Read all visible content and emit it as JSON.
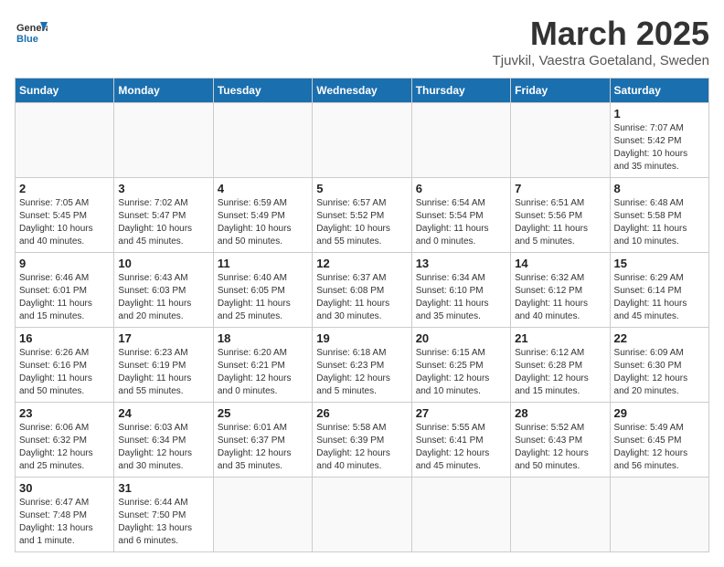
{
  "header": {
    "logo_general": "General",
    "logo_blue": "Blue",
    "month_title": "March 2025",
    "location": "Tjuvkil, Vaestra Goetaland, Sweden"
  },
  "weekdays": [
    "Sunday",
    "Monday",
    "Tuesday",
    "Wednesday",
    "Thursday",
    "Friday",
    "Saturday"
  ],
  "weeks": [
    [
      {
        "day": "",
        "info": ""
      },
      {
        "day": "",
        "info": ""
      },
      {
        "day": "",
        "info": ""
      },
      {
        "day": "",
        "info": ""
      },
      {
        "day": "",
        "info": ""
      },
      {
        "day": "",
        "info": ""
      },
      {
        "day": "1",
        "info": "Sunrise: 7:07 AM\nSunset: 5:42 PM\nDaylight: 10 hours\nand 35 minutes."
      }
    ],
    [
      {
        "day": "2",
        "info": "Sunrise: 7:05 AM\nSunset: 5:45 PM\nDaylight: 10 hours\nand 40 minutes."
      },
      {
        "day": "3",
        "info": "Sunrise: 7:02 AM\nSunset: 5:47 PM\nDaylight: 10 hours\nand 45 minutes."
      },
      {
        "day": "4",
        "info": "Sunrise: 6:59 AM\nSunset: 5:49 PM\nDaylight: 10 hours\nand 50 minutes."
      },
      {
        "day": "5",
        "info": "Sunrise: 6:57 AM\nSunset: 5:52 PM\nDaylight: 10 hours\nand 55 minutes."
      },
      {
        "day": "6",
        "info": "Sunrise: 6:54 AM\nSunset: 5:54 PM\nDaylight: 11 hours\nand 0 minutes."
      },
      {
        "day": "7",
        "info": "Sunrise: 6:51 AM\nSunset: 5:56 PM\nDaylight: 11 hours\nand 5 minutes."
      },
      {
        "day": "8",
        "info": "Sunrise: 6:48 AM\nSunset: 5:58 PM\nDaylight: 11 hours\nand 10 minutes."
      }
    ],
    [
      {
        "day": "9",
        "info": "Sunrise: 6:46 AM\nSunset: 6:01 PM\nDaylight: 11 hours\nand 15 minutes."
      },
      {
        "day": "10",
        "info": "Sunrise: 6:43 AM\nSunset: 6:03 PM\nDaylight: 11 hours\nand 20 minutes."
      },
      {
        "day": "11",
        "info": "Sunrise: 6:40 AM\nSunset: 6:05 PM\nDaylight: 11 hours\nand 25 minutes."
      },
      {
        "day": "12",
        "info": "Sunrise: 6:37 AM\nSunset: 6:08 PM\nDaylight: 11 hours\nand 30 minutes."
      },
      {
        "day": "13",
        "info": "Sunrise: 6:34 AM\nSunset: 6:10 PM\nDaylight: 11 hours\nand 35 minutes."
      },
      {
        "day": "14",
        "info": "Sunrise: 6:32 AM\nSunset: 6:12 PM\nDaylight: 11 hours\nand 40 minutes."
      },
      {
        "day": "15",
        "info": "Sunrise: 6:29 AM\nSunset: 6:14 PM\nDaylight: 11 hours\nand 45 minutes."
      }
    ],
    [
      {
        "day": "16",
        "info": "Sunrise: 6:26 AM\nSunset: 6:16 PM\nDaylight: 11 hours\nand 50 minutes."
      },
      {
        "day": "17",
        "info": "Sunrise: 6:23 AM\nSunset: 6:19 PM\nDaylight: 11 hours\nand 55 minutes."
      },
      {
        "day": "18",
        "info": "Sunrise: 6:20 AM\nSunset: 6:21 PM\nDaylight: 12 hours\nand 0 minutes."
      },
      {
        "day": "19",
        "info": "Sunrise: 6:18 AM\nSunset: 6:23 PM\nDaylight: 12 hours\nand 5 minutes."
      },
      {
        "day": "20",
        "info": "Sunrise: 6:15 AM\nSunset: 6:25 PM\nDaylight: 12 hours\nand 10 minutes."
      },
      {
        "day": "21",
        "info": "Sunrise: 6:12 AM\nSunset: 6:28 PM\nDaylight: 12 hours\nand 15 minutes."
      },
      {
        "day": "22",
        "info": "Sunrise: 6:09 AM\nSunset: 6:30 PM\nDaylight: 12 hours\nand 20 minutes."
      }
    ],
    [
      {
        "day": "23",
        "info": "Sunrise: 6:06 AM\nSunset: 6:32 PM\nDaylight: 12 hours\nand 25 minutes."
      },
      {
        "day": "24",
        "info": "Sunrise: 6:03 AM\nSunset: 6:34 PM\nDaylight: 12 hours\nand 30 minutes."
      },
      {
        "day": "25",
        "info": "Sunrise: 6:01 AM\nSunset: 6:37 PM\nDaylight: 12 hours\nand 35 minutes."
      },
      {
        "day": "26",
        "info": "Sunrise: 5:58 AM\nSunset: 6:39 PM\nDaylight: 12 hours\nand 40 minutes."
      },
      {
        "day": "27",
        "info": "Sunrise: 5:55 AM\nSunset: 6:41 PM\nDaylight: 12 hours\nand 45 minutes."
      },
      {
        "day": "28",
        "info": "Sunrise: 5:52 AM\nSunset: 6:43 PM\nDaylight: 12 hours\nand 50 minutes."
      },
      {
        "day": "29",
        "info": "Sunrise: 5:49 AM\nSunset: 6:45 PM\nDaylight: 12 hours\nand 56 minutes."
      }
    ],
    [
      {
        "day": "30",
        "info": "Sunrise: 6:47 AM\nSunset: 7:48 PM\nDaylight: 13 hours\nand 1 minute."
      },
      {
        "day": "31",
        "info": "Sunrise: 6:44 AM\nSunset: 7:50 PM\nDaylight: 13 hours\nand 6 minutes."
      },
      {
        "day": "",
        "info": ""
      },
      {
        "day": "",
        "info": ""
      },
      {
        "day": "",
        "info": ""
      },
      {
        "day": "",
        "info": ""
      },
      {
        "day": "",
        "info": ""
      }
    ]
  ]
}
